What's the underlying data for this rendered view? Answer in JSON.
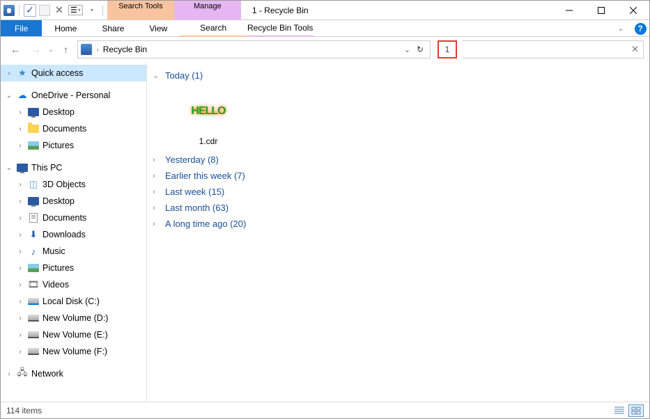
{
  "window": {
    "title": "1 - Recycle Bin"
  },
  "qat": {
    "customize_caret": "▾"
  },
  "context_tabs": {
    "search": {
      "top": "Search Tools",
      "bottom": "Search"
    },
    "manage": {
      "top": "Manage",
      "bottom": "Recycle Bin Tools"
    }
  },
  "ribbon": {
    "file": "File",
    "home": "Home",
    "share": "Share",
    "view": "View"
  },
  "address": {
    "location": "Recycle Bin",
    "dropdown": "⌄"
  },
  "search": {
    "value": "1"
  },
  "sidebar": {
    "quick_access": "Quick access",
    "onedrive": "OneDrive - Personal",
    "onedrive_children": [
      {
        "label": "Desktop",
        "icon": "monitor"
      },
      {
        "label": "Documents",
        "icon": "folder"
      },
      {
        "label": "Pictures",
        "icon": "pic"
      }
    ],
    "this_pc": "This PC",
    "this_pc_children": [
      {
        "label": "3D Objects",
        "icon": "cube"
      },
      {
        "label": "Desktop",
        "icon": "monitor"
      },
      {
        "label": "Documents",
        "icon": "doc"
      },
      {
        "label": "Downloads",
        "icon": "download"
      },
      {
        "label": "Music",
        "icon": "music"
      },
      {
        "label": "Pictures",
        "icon": "pic"
      },
      {
        "label": "Videos",
        "icon": "video"
      },
      {
        "label": "Local Disk (C:)",
        "icon": "drive-c"
      },
      {
        "label": "New Volume (D:)",
        "icon": "drive"
      },
      {
        "label": "New Volume (E:)",
        "icon": "drive"
      },
      {
        "label": "New Volume (F:)",
        "icon": "drive"
      }
    ],
    "network": "Network"
  },
  "groups": [
    {
      "label": "Today (1)",
      "expanded": true
    },
    {
      "label": "Yesterday (8)",
      "expanded": false
    },
    {
      "label": "Earlier this week (7)",
      "expanded": false
    },
    {
      "label": "Last week (15)",
      "expanded": false
    },
    {
      "label": "Last month (63)",
      "expanded": false
    },
    {
      "label": "A long time ago (20)",
      "expanded": false
    }
  ],
  "file": {
    "name": "1.cdr",
    "thumb_text": "HELLO"
  },
  "status": {
    "text": "114 items"
  }
}
